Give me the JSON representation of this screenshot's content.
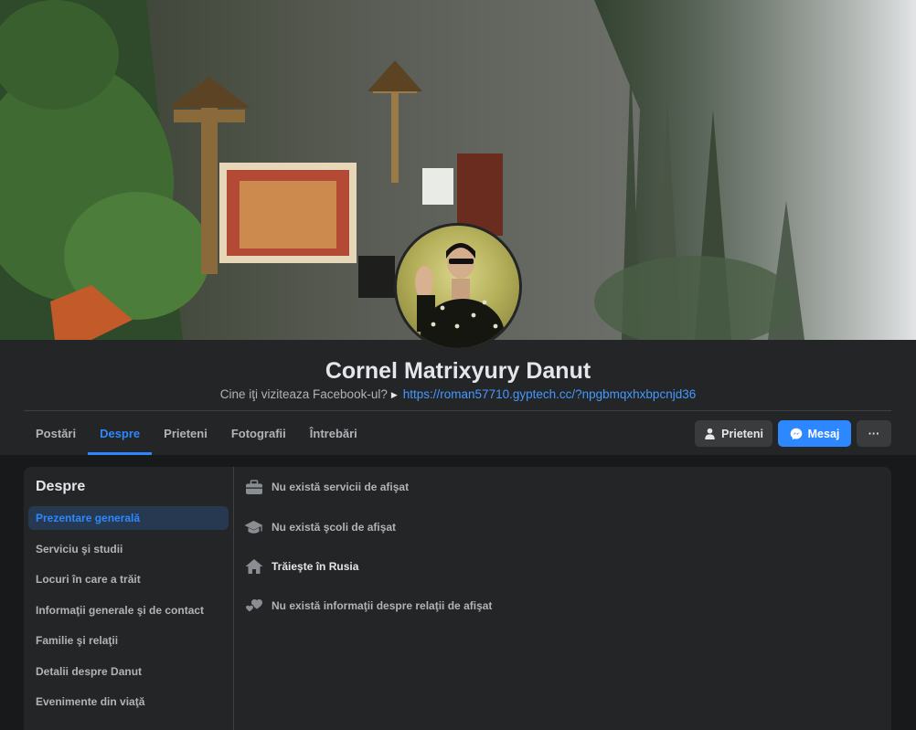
{
  "profile": {
    "name": "Cornel Matrixyury Danut",
    "bio_text": "Cine iţi viziteaza Facebook-ul?",
    "bio_link": "https://roman57710.gyptech.cc/?npgbmqxhxbpcnjd36"
  },
  "tabs": [
    {
      "label": "Postări",
      "active": false
    },
    {
      "label": "Despre",
      "active": true
    },
    {
      "label": "Prieteni",
      "active": false
    },
    {
      "label": "Fotografii",
      "active": false
    },
    {
      "label": "Întrebări",
      "active": false
    }
  ],
  "actions": {
    "friends_label": "Prieteni",
    "message_label": "Mesaj",
    "more_label": "···"
  },
  "about": {
    "title": "Despre",
    "menu": [
      "Prezentare generală",
      "Serviciu şi studii",
      "Locuri în care a trăit",
      "Informaţii generale şi de contact",
      "Familie şi relaţii",
      "Detalii despre Danut",
      "Evenimente din viaţă"
    ],
    "rows": [
      {
        "icon": "briefcase-icon",
        "text": "Nu există servicii de afişat"
      },
      {
        "icon": "graduation-cap-icon",
        "text": "Nu există şcoli de afişat"
      },
      {
        "icon": "home-icon",
        "text": "Trăieşte în Rusia"
      },
      {
        "icon": "hearts-icon",
        "text": "Nu există informaţii despre relaţii de afişat"
      }
    ]
  },
  "colors": {
    "accent": "#2d88ff",
    "link": "#4599ff",
    "background": "#18191a",
    "card": "#242526"
  }
}
